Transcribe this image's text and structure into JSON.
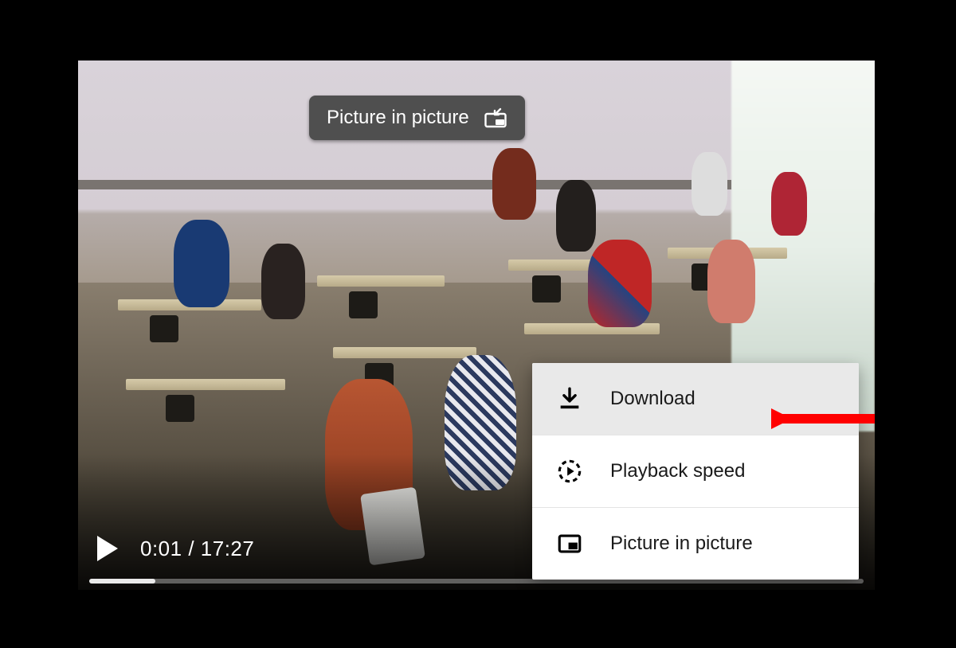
{
  "tooltip": {
    "label": "Picture in picture"
  },
  "player": {
    "current_time": "0:01",
    "duration": "17:27",
    "separator": " / "
  },
  "menu": {
    "items": [
      {
        "label": "Download",
        "icon": "download-icon",
        "hover": true
      },
      {
        "label": "Playback speed",
        "icon": "playback-speed-icon",
        "hover": false
      },
      {
        "label": "Picture in picture",
        "icon": "pip-icon",
        "hover": false
      }
    ]
  },
  "annotation": {
    "arrow_color": "#ff0000"
  }
}
